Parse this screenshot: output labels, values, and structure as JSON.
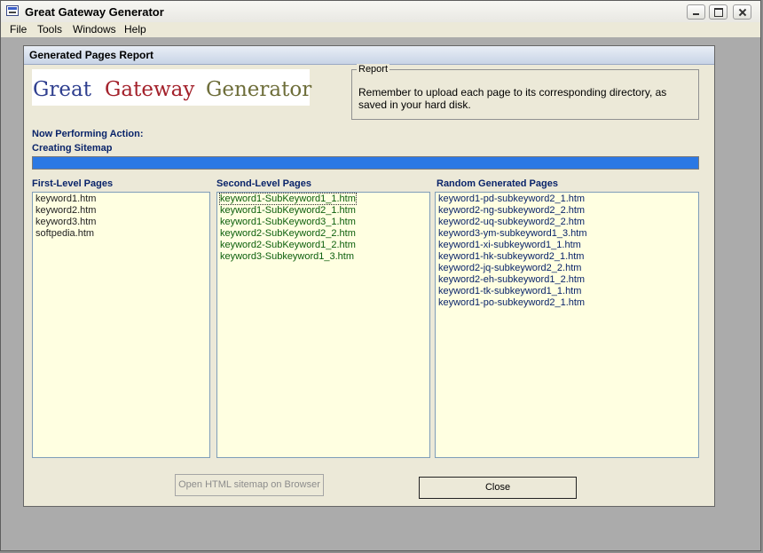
{
  "window": {
    "title": "Great Gateway Generator"
  },
  "menu": [
    "File",
    "Tools",
    "Windows",
    "Help"
  ],
  "dialog": {
    "title": "Generated Pages Report"
  },
  "logo": {
    "words": [
      "Great",
      "Gateway",
      "Generator"
    ]
  },
  "report": {
    "legend": "Report",
    "text": "Remember to upload each page to its corresponding directory, as saved in your hard disk."
  },
  "action": {
    "label": "Now Performing Action:",
    "value": "Creating Sitemap",
    "progress": 1.0
  },
  "lists": {
    "first": {
      "header": "First-Level Pages",
      "items": [
        "keyword1.htm",
        "keyword2.htm",
        "keyword3.htm",
        "softpedia.htm"
      ]
    },
    "second": {
      "header": "Second-Level Pages",
      "items": [
        "keyword1-SubKeyword1_1.htm",
        "keyword1-SubKeyword2_1.htm",
        "keyword1-SubKeyword3_1.htm",
        "keyword2-SubKeyword2_2.htm",
        "keyword2-SubKeyword1_2.htm",
        "keyword3-Subkeyword1_3.htm"
      ]
    },
    "random": {
      "header": "Random Generated Pages",
      "items": [
        "keyword1-pd-subkeyword2_1.htm",
        "keyword2-ng-subkeyword2_2.htm",
        "keyword2-uq-subkeyword2_2.htm",
        "keyword3-ym-subkeyword1_3.htm",
        "keyword1-xi-subkeyword1_1.htm",
        "keyword1-hk-subkeyword2_1.htm",
        "keyword2-jq-subkeyword2_2.htm",
        "keyword2-eh-subkeyword1_2.htm",
        "keyword1-tk-subkeyword1_1.htm",
        "keyword1-po-subkeyword2_1.htm"
      ]
    }
  },
  "buttons": {
    "open_sitemap": "Open HTML sitemap on Browser",
    "close": "Close"
  },
  "colors": {
    "progress": "#2b78e4",
    "list_bg": "#ffffe1",
    "header_blue": "#0a246a"
  }
}
